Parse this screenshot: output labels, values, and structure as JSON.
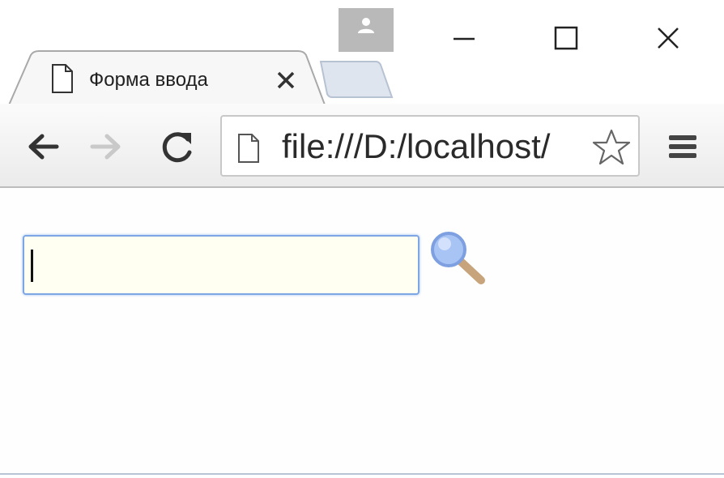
{
  "tab": {
    "title": "Форма ввода",
    "favicon": "page-icon",
    "close_icon": "close-icon"
  },
  "window_controls": {
    "profile": "person-icon",
    "minimize": "minimize-icon",
    "maximize": "maximize-icon",
    "close": "close-icon"
  },
  "toolbar": {
    "back": "arrow-left-icon",
    "forward": "arrow-right-icon",
    "reload": "reload-icon",
    "menu": "hamburger-menu-icon"
  },
  "omnibox": {
    "url": "file:///D:/localhost/",
    "page_icon": "page-icon",
    "bookmark_icon": "star-icon"
  },
  "page": {
    "search_value": "",
    "search_button_icon": "magnifier-icon"
  },
  "colors": {
    "input_border": "#7ea6e4",
    "input_background": "#fffff2",
    "profile_button": "#b9b9b9"
  }
}
